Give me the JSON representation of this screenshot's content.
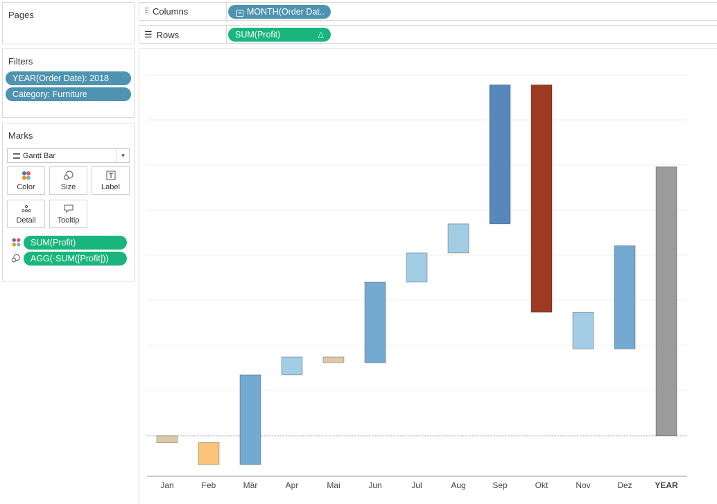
{
  "pages": {
    "title": "Pages"
  },
  "columns": {
    "label": "Columns",
    "pill": "MONTH(Order Dat.."
  },
  "rows": {
    "label": "Rows",
    "pill": "SUM(Profit)"
  },
  "filters": {
    "title": "Filters",
    "items": [
      "YEAR(Order Date): 2018",
      "Category: Furniture"
    ]
  },
  "marks": {
    "title": "Marks",
    "mark_type": "Gantt Bar",
    "buttons": [
      "Color",
      "Size",
      "Label",
      "Detail",
      "Tooltip"
    ],
    "fields": [
      "SUM(Profit)",
      "AGG(-SUM([Profit]))"
    ]
  },
  "colors": {
    "pill_blue": "#4e93b0",
    "pill_green": "#18b57c",
    "neg_small": "#ddc9a8",
    "neg_orange": "#fbc47b",
    "pos_light": "#a3cde5",
    "pos_mid": "#74a9d2",
    "pos_dark": "#5689ba",
    "neg_dark": "#9d3b22",
    "total": "#9b9b9b"
  },
  "chart_data": {
    "type": "waterfall",
    "categories": [
      "Jan",
      "Feb",
      "Mär",
      "Apr",
      "Mai",
      "Jun",
      "Jul",
      "Aug",
      "Sep",
      "Okt",
      "Nov",
      "Dez",
      "YEAR"
    ],
    "deltas": [
      -0.15,
      -0.49,
      2.0,
      0.4,
      -0.13,
      1.8,
      0.65,
      0.65,
      3.1,
      -5.07,
      -0.82,
      2.3,
      6.0
    ],
    "bar_colors": [
      "neg_small",
      "neg_orange",
      "pos_mid",
      "pos_light",
      "neg_small",
      "pos_mid",
      "pos_light",
      "pos_light",
      "pos_dark",
      "neg_dark",
      "pos_light",
      "pos_mid",
      "total"
    ],
    "ylim": [
      -0.9,
      8.5
    ],
    "xlabel": "",
    "ylabel": ""
  }
}
